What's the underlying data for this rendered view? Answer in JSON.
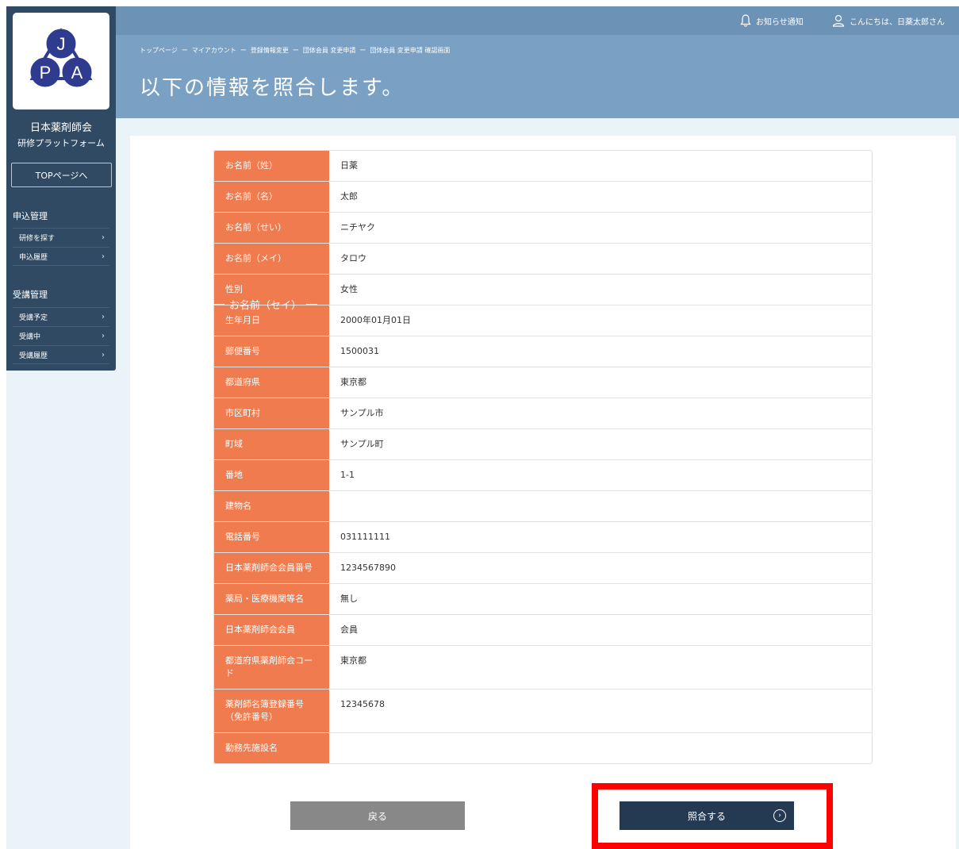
{
  "sidebar": {
    "org_name": "日本薬剤師会",
    "platform_name": "研修プラットフォーム",
    "top_button": "TOPページへ",
    "sections": [
      {
        "title": "申込管理",
        "items": [
          "研修を探す",
          "申込履歴"
        ]
      },
      {
        "title": "受講管理",
        "items": [
          "受講予定",
          "受講中",
          "受講履歴"
        ]
      }
    ],
    "logo_letters": [
      "J",
      "P",
      "A"
    ]
  },
  "header": {
    "notify_label": "お知らせ通知",
    "greeting": "こんにちは、日薬太郎さん",
    "breadcrumb": [
      "トップページ",
      "マイアカウント",
      "登録情報変更",
      "団体会員 変更申請",
      "団体会員 変更申請 確認画面"
    ],
    "breadcrumb_sep": "ー",
    "title": "以下の情報を照合します。"
  },
  "form": {
    "rows": [
      {
        "label": "お名前（姓）",
        "value": "日薬"
      },
      {
        "label": "お名前（名）",
        "value": "太郎"
      },
      {
        "label": "お名前（せい）",
        "value": "ニチヤク"
      },
      {
        "label": "お名前（メイ）",
        "value": "タロウ"
      },
      {
        "label": "性別",
        "value": "女性"
      },
      {
        "label": "生年月日",
        "value": "2000年01月01日"
      },
      {
        "label": "郵便番号",
        "value": "1500031"
      },
      {
        "label": "都道府県",
        "value": "東京都"
      },
      {
        "label": "市区町村",
        "value": "サンプル市"
      },
      {
        "label": "町域",
        "value": "サンプル町"
      },
      {
        "label": "番地",
        "value": "1-1"
      },
      {
        "label": "建物名",
        "value": ""
      },
      {
        "label": "電話番号",
        "value": "031111111"
      },
      {
        "label": "日本薬剤師会会員番号",
        "value": "1234567890"
      },
      {
        "label": "薬局・医療機関等名",
        "value": "無し"
      },
      {
        "label": "日本薬剤師会会員",
        "value": "会員"
      },
      {
        "label": "都道府県薬剤師会コード",
        "value": "東京都"
      },
      {
        "label": "薬剤師名簿登録番号（免許番号）",
        "value": "12345678"
      },
      {
        "label": "勤務先施設名",
        "value": ""
      }
    ],
    "overlay_label": "お名前（セイ）"
  },
  "actions": {
    "back_label": "戻る",
    "submit_label": "照合する"
  },
  "colors": {
    "sidebar": "#2f4a62",
    "header": "#7aa1c3",
    "label_bg": "#ef7b4e",
    "submit": "#233a52",
    "highlight": "#ff0000"
  }
}
